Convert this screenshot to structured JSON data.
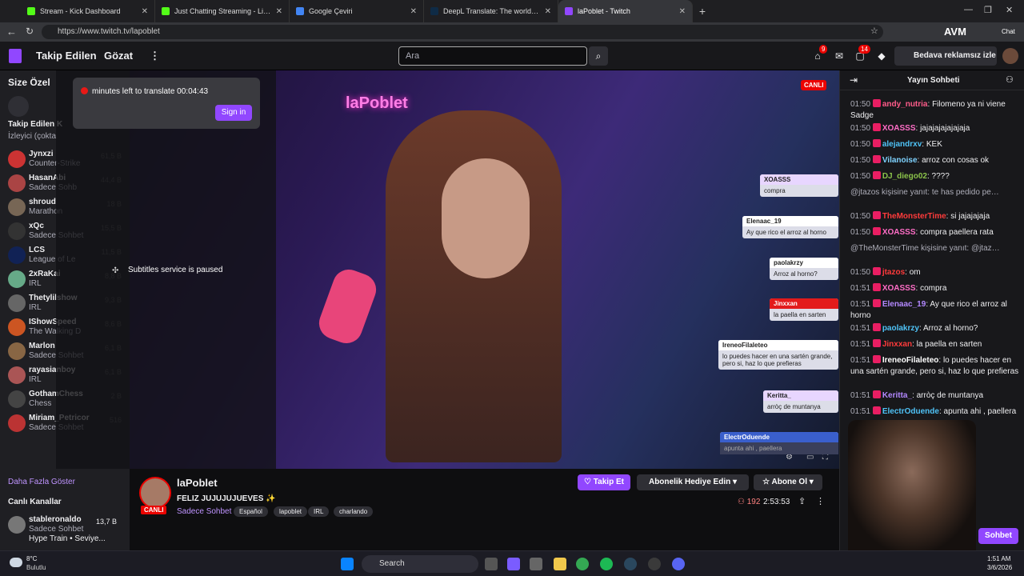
{
  "browser": {
    "tabs": [
      {
        "title": "Stream - Kick Dashboard",
        "color": "#53fc18"
      },
      {
        "title": "Just Chatting Streaming - Live Strea",
        "color": "#53fc18"
      },
      {
        "title": "Google Çeviri",
        "color": "#4285f4"
      },
      {
        "title": "DeepL Translate: The world's mos",
        "color": "#0f2b46"
      },
      {
        "title": "laPoblet - Twitch",
        "color": "#9147ff"
      }
    ],
    "url": "https://www.twitch.tv/lapoblet",
    "profile_label": "AVM",
    "chat_label": "Chat"
  },
  "nav": {
    "following": "Takip Edilen",
    "browse": "Gözat",
    "search_placeholder": "Ara",
    "badge_left": "9",
    "badge_right": "14",
    "ad_free": "Bedava reklamsız izle"
  },
  "sidebar": {
    "header": "Size Özel",
    "followed_header": "Takip Edilen K",
    "followed_sub": "İzleyici (çokta",
    "channels": [
      {
        "name": "Jynxzi",
        "game": "Counter-Strike",
        "viewers": "61,5 B",
        "color": "#c33"
      },
      {
        "name": "HasanAbi",
        "game": "Sadece Sohb",
        "viewers": "44,4 B",
        "color": "#a44"
      },
      {
        "name": "shroud",
        "game": "Marathon",
        "viewers": "18 B",
        "color": "#765"
      },
      {
        "name": "xQc",
        "game": "Sadece Sohbet",
        "viewers": "15,5 B",
        "color": "#333"
      },
      {
        "name": "LCS",
        "game": "League of Le",
        "viewers": "11,5 B",
        "color": "#125"
      },
      {
        "name": "2xRaKai",
        "game": "IRL",
        "viewers": "8,8 B",
        "color": "#6a8"
      },
      {
        "name": "Thetylilshow",
        "game": "IRL",
        "viewers": "9,3 B",
        "color": "#666"
      },
      {
        "name": "IShowSpeed",
        "game": "The Walking D",
        "viewers": "8,6 B",
        "color": "#c52"
      },
      {
        "name": "Marlon",
        "game": "Sadece Sohbet",
        "viewers": "6,1 B",
        "color": "#864"
      },
      {
        "name": "rayasianboy",
        "game": "IRL",
        "viewers": "6,1 B",
        "color": "#a55"
      },
      {
        "name": "GothamChess",
        "game": "Chess",
        "viewers": "2 B",
        "color": "#444"
      },
      {
        "name": "Miriam_Petricor",
        "game": "Sadece Sohbet",
        "viewers": "516",
        "color": "#b33"
      }
    ],
    "show_more": "Daha Fazla Göster",
    "live_channels": "Canlı Kanallar",
    "live_item": {
      "name": "stableronaldo",
      "game": "Sadece Sohbet",
      "viewers": "13,7 B",
      "extra": "Hype Train • Seviye..."
    }
  },
  "overlay": {
    "timer": "minutes left to translate 00:04:43",
    "sign_in": "Sign in",
    "subtitles": "Subtitles service is paused"
  },
  "video": {
    "live_badge": "CANLI",
    "neon": "laPoblet",
    "overlay_msgs": [
      {
        "user": "XOASSS",
        "text": "compra"
      },
      {
        "user": "Elenaac_19",
        "text": "Ay que rico el arroz al horno"
      },
      {
        "user": "paolakrzy",
        "text": "Arroz al horno?"
      },
      {
        "user": "Jinxxan",
        "text": "la paella en sarten"
      },
      {
        "user": "IreneoFilaleteo",
        "text": "lo puedes hacer en una sartén grande, pero si, haz lo que prefieras"
      },
      {
        "user": "Keritta_",
        "text": "arròç de muntanya"
      },
      {
        "user": "ElectrOduende",
        "text": "apunta ahi , paellera"
      }
    ]
  },
  "channel": {
    "name": "laPoblet",
    "title": "FELIZ JUJUJUJUEVES ✨",
    "live": "CANLI",
    "category": "Sadece Sohbet",
    "tags": [
      "Español",
      "lapoblet",
      "IRL",
      "charlando"
    ],
    "follow": "Takip Et",
    "gift": "Abonelik Hediye Edin",
    "subscribe": "Abone Ol",
    "viewers": "192",
    "uptime": "2:53:53"
  },
  "chat": {
    "title": "Yayın Sohbeti",
    "messages": [
      {
        "time": "01:50",
        "user": "andy_nutria",
        "color": "#ff5c8a",
        "text": "Filomeno ya ni viene Sadge"
      },
      {
        "time": "01:50",
        "user": "XOASSS",
        "color": "#ff6ec7",
        "text": "jajajajajajajaja"
      },
      {
        "time": "01:50",
        "user": "alejandrxv",
        "color": "#4fc3f7",
        "text": "KEK"
      },
      {
        "time": "01:50",
        "user": "Vilanoise",
        "color": "#7fd3ff",
        "text": "arroz con cosas ok"
      },
      {
        "time": "01:50",
        "user": "DJ_diego02",
        "color": "#8bc34a",
        "text": "????"
      },
      {
        "time": "",
        "user": "",
        "color": "#adadb8",
        "text": "@jtazos kişisine yanıt: te has pedido pe…"
      },
      {
        "time": "01:50",
        "user": "TheMonsterTime",
        "color": "#ff3b3b",
        "text": "si jajajajaja"
      },
      {
        "time": "01:50",
        "user": "XOASSS",
        "color": "#ff6ec7",
        "text": "compra paellera rata"
      },
      {
        "time": "",
        "user": "",
        "color": "#adadb8",
        "text": "@TheMonsterTime kişisine yanıt: @jtaz…"
      },
      {
        "time": "01:50",
        "user": "jtazos",
        "color": "#ff3b3b",
        "text": "om"
      },
      {
        "time": "01:51",
        "user": "XOASSS",
        "color": "#ff6ec7",
        "text": "compra"
      },
      {
        "time": "01:51",
        "user": "Elenaac_19",
        "color": "#b388ff",
        "text": "Ay que rico el arroz al horno"
      },
      {
        "time": "01:51",
        "user": "paolakrzy",
        "color": "#4fc3f7",
        "text": "Arroz al horno?"
      },
      {
        "time": "01:51",
        "user": "Jinxxan",
        "color": "#ff3b3b",
        "text": "la paella en sarten"
      },
      {
        "time": "01:51",
        "user": "IreneoFilaleteo",
        "color": "#ffffff",
        "text": "lo puedes hacer en una sartén grande, pero si, haz lo que prefieras"
      },
      {
        "time": "01:51",
        "user": "Keritta_",
        "color": "#b388ff",
        "text": "arròç de muntanya"
      },
      {
        "time": "01:51",
        "user": "ElectrOduende",
        "color": "#4fc3f7",
        "text": "apunta ahi , paellera"
      }
    ],
    "send": "Sohbet"
  },
  "taskbar": {
    "weather_temp": "8°C",
    "weather_desc": "Bulutlu",
    "search": "Search",
    "time": "1:51 AM",
    "date": "3/6/2026"
  }
}
